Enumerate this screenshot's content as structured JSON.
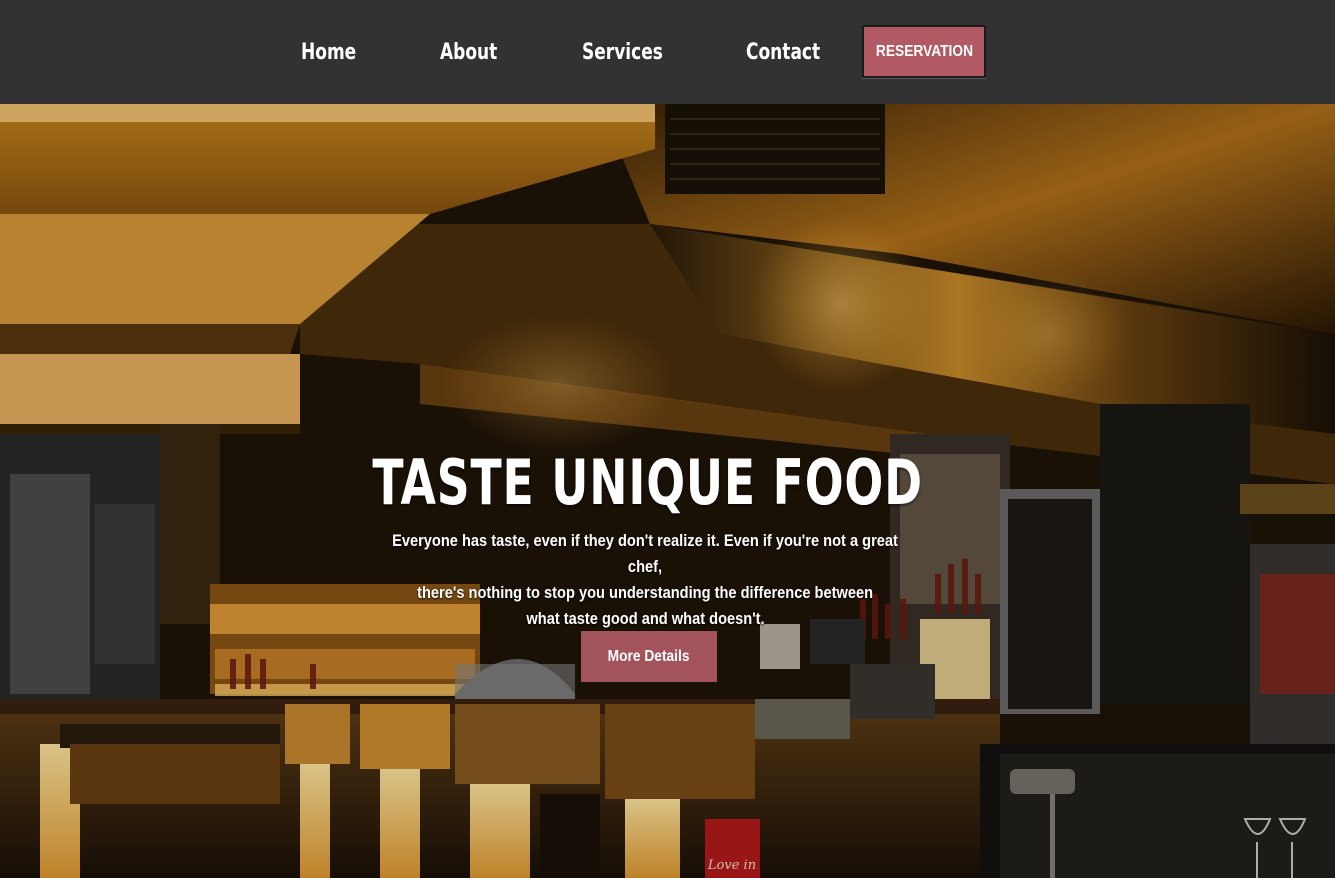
{
  "nav": {
    "links": [
      {
        "label": "Home"
      },
      {
        "label": "About"
      },
      {
        "label": "Services"
      },
      {
        "label": "Contact"
      }
    ],
    "reservation_label": "RESERVATION"
  },
  "hero": {
    "title": "TASTE UNIQUE FOOD",
    "lines": [
      "Everyone has taste, even if they don't realize it. Even if you're not a great chef,",
      "there's nothing to stop you understanding the difference between",
      "what taste good and what doesn't."
    ],
    "button_label": "More Details",
    "sign_text": "Love in"
  },
  "colors": {
    "nav_bg": "#323232",
    "reservation_bg": "#b15a63",
    "details_bg": "#a2535c"
  }
}
